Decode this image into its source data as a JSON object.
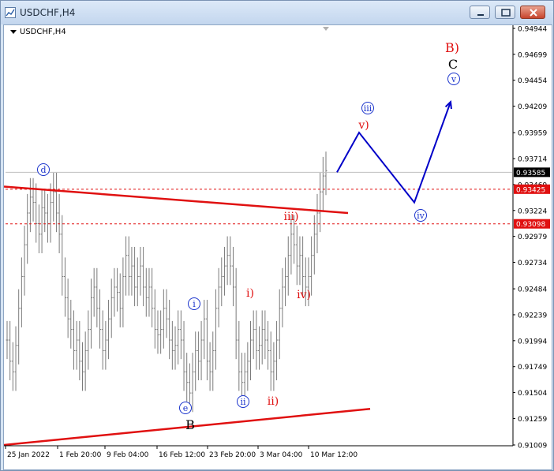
{
  "window": {
    "title": "USDCHF,H4",
    "icons": {
      "app": "chart-app-icon",
      "minimize": "minimize-icon",
      "maximize": "maximize-icon",
      "close": "close-icon"
    }
  },
  "chart_label": "USDCHF,H4",
  "colors": {
    "up_candle": "#7a7a7a",
    "trendline": "#e01010",
    "wave_path": "#0000c8",
    "blue_label": "#1a33cc",
    "red_label": "#e01010",
    "grid_line": "#bfbfbf",
    "current_price_bg": "#000000",
    "level_price_bg": "#e01010"
  },
  "chart_data": {
    "type": "ohlc",
    "symbol": "USDCHF",
    "timeframe": "H4",
    "ylim": [
      0.91009,
      0.94944
    ],
    "y_ticks": [
      "0.94944",
      "0.94699",
      "0.94454",
      "0.94209",
      "0.93959",
      "0.93714",
      "0.93469",
      "0.93224",
      "0.92979",
      "0.92734",
      "0.92484",
      "0.92239",
      "0.91994",
      "0.91749",
      "0.91504",
      "0.91259",
      "0.91009"
    ],
    "x_ticks": [
      "25 Jan 2022",
      "1 Feb 20:00",
      "9 Feb 04:00",
      "16 Feb 12:00",
      "23 Feb 20:00",
      "3 Mar 04:00",
      "10 Mar 12:00"
    ],
    "price_labels": [
      {
        "text": "0.93585",
        "style": "current"
      },
      {
        "text": "0.93425",
        "style": "level"
      },
      {
        "text": "0.93098",
        "style": "level"
      }
    ],
    "horizontal_levels": [
      {
        "price": 0.93585,
        "style": "solid-gray"
      },
      {
        "price": 0.93425,
        "style": "dashed-red"
      },
      {
        "price": 0.93098,
        "style": "dashed-red"
      }
    ],
    "series_close": [
      0.92,
      0.918,
      0.917,
      0.9195,
      0.923,
      0.926,
      0.929,
      0.932,
      0.9335,
      0.933,
      0.931,
      0.93,
      0.9325,
      0.932,
      0.931,
      0.933,
      0.934,
      0.932,
      0.93,
      0.926,
      0.924,
      0.922,
      0.921,
      0.919,
      0.92,
      0.918,
      0.917,
      0.919,
      0.921,
      0.924,
      0.925,
      0.923,
      0.921,
      0.919,
      0.92,
      0.922,
      0.924,
      0.925,
      0.9245,
      0.923,
      0.926,
      0.928,
      0.926,
      0.927,
      0.925,
      0.926,
      0.927,
      0.925,
      0.924,
      0.925,
      0.923,
      0.921,
      0.9205,
      0.921,
      0.923,
      0.922,
      0.92,
      0.919,
      0.9195,
      0.921,
      0.92,
      0.917,
      0.916,
      0.915,
      0.917,
      0.919,
      0.918,
      0.92,
      0.922,
      0.918,
      0.917,
      0.919,
      0.923,
      0.925,
      0.926,
      0.927,
      0.928,
      0.927,
      0.925,
      0.92,
      0.917,
      0.916,
      0.917,
      0.918,
      0.92,
      0.921,
      0.919,
      0.9195,
      0.921,
      0.92,
      0.919,
      0.917,
      0.918,
      0.92,
      0.923,
      0.925,
      0.926,
      0.928,
      0.93,
      0.929,
      0.927,
      0.928,
      0.926,
      0.925,
      0.926,
      0.928,
      0.93,
      0.932,
      0.934,
      0.9355,
      0.936
    ],
    "wave_projection": [
      {
        "label": "start",
        "price": 0.93585
      },
      {
        "label": "v)",
        "price": 0.9396
      },
      {
        "label": "iv",
        "price": 0.933
      },
      {
        "label": "v",
        "price": 0.9425
      }
    ],
    "trendlines": [
      {
        "name": "upper",
        "from": 0.9345,
        "to": 0.932
      },
      {
        "name": "lower",
        "from": 0.91009,
        "to": 0.9135
      }
    ],
    "annotations": [
      {
        "text": "d",
        "circled": true,
        "color": "blue"
      },
      {
        "text": "i",
        "circled": true,
        "color": "blue"
      },
      {
        "text": "e",
        "circled": true,
        "color": "blue"
      },
      {
        "text": "B",
        "circled": false,
        "color": "black"
      },
      {
        "text": "ii",
        "circled": true,
        "color": "blue"
      },
      {
        "text": "i)",
        "circled": false,
        "color": "red"
      },
      {
        "text": "ii)",
        "circled": false,
        "color": "red"
      },
      {
        "text": "iii)",
        "circled": false,
        "color": "red"
      },
      {
        "text": "iv)",
        "circled": false,
        "color": "red"
      },
      {
        "text": "iii",
        "circled": true,
        "color": "blue"
      },
      {
        "text": "v)",
        "circled": false,
        "color": "red"
      },
      {
        "text": "iv",
        "circled": true,
        "color": "blue"
      },
      {
        "text": "v",
        "circled": true,
        "color": "blue"
      },
      {
        "text": "B)",
        "circled": false,
        "color": "red"
      },
      {
        "text": "C",
        "circled": false,
        "color": "black"
      }
    ]
  }
}
